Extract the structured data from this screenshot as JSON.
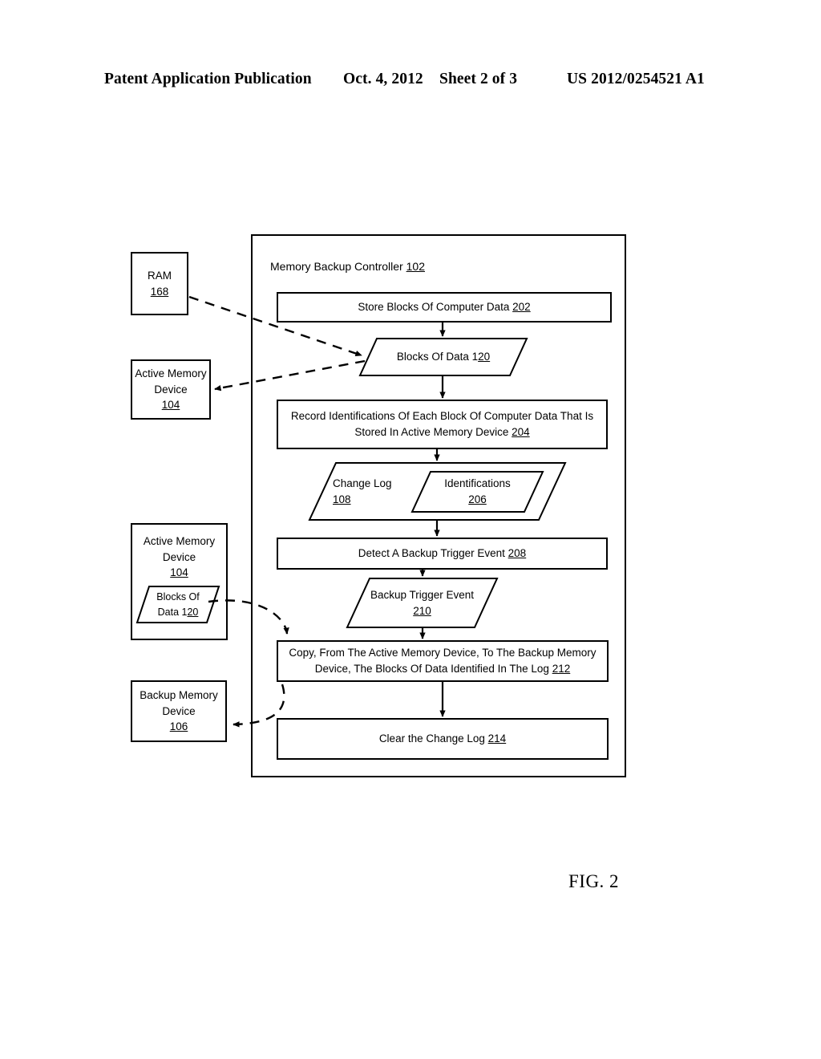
{
  "header": {
    "publication": "Patent Application Publication",
    "date": "Oct. 4, 2012",
    "sheet": "Sheet 2 of 3",
    "number": "US 2012/0254521 A1"
  },
  "figure": {
    "label": "FIG. 2",
    "controller": {
      "title_text": "Memory Backup Controller ",
      "title_ref": "102"
    },
    "left_blocks": [
      {
        "name": "ram-box",
        "lines": [
          "RAM"
        ],
        "ref": "168"
      },
      {
        "name": "active-memory-device-top",
        "lines": [
          "Active Memory",
          "Device"
        ],
        "ref": "104"
      },
      {
        "name": "active-memory-device-bottom",
        "lines": [
          "Active Memory",
          "Device"
        ],
        "ref": "104",
        "nested": {
          "name": "blocks-of-data-nested",
          "line1": "Blocks Of",
          "line2_text": "Data 1",
          "line2_ref": "20"
        }
      },
      {
        "name": "backup-memory-device",
        "lines": [
          "Backup Memory",
          "Device"
        ],
        "ref": "106"
      }
    ],
    "steps": [
      {
        "name": "store-blocks-step",
        "text": "Store Blocks Of Computer Data ",
        "ref": "202"
      },
      {
        "name": "record-identifications-step",
        "line1": "Record Identifications Of Each Block Of Computer Data That Is",
        "line2": "Stored In Active Memory Device ",
        "ref": "204"
      },
      {
        "name": "detect-backup-trigger-step",
        "text": "Detect A Backup Trigger Event ",
        "ref": "208"
      },
      {
        "name": "copy-blocks-step",
        "line1": "Copy, From The Active Memory Device, To The Backup Memory",
        "line2": "Device, The Blocks Of Data Identified In The Log ",
        "ref": "212"
      },
      {
        "name": "clear-change-log-step",
        "text": "Clear the Change Log ",
        "ref": "214"
      }
    ],
    "data_objects": [
      {
        "name": "blocks-of-data-flow",
        "text": "Blocks Of Data 1",
        "ref": "20"
      },
      {
        "name": "change-log-object",
        "line1": "Change Log",
        "ref": "108"
      },
      {
        "name": "identifications-object",
        "line1": "Identifications",
        "ref": "206"
      },
      {
        "name": "backup-trigger-event-object",
        "line1": "Backup Trigger Event",
        "ref": "210"
      }
    ]
  }
}
